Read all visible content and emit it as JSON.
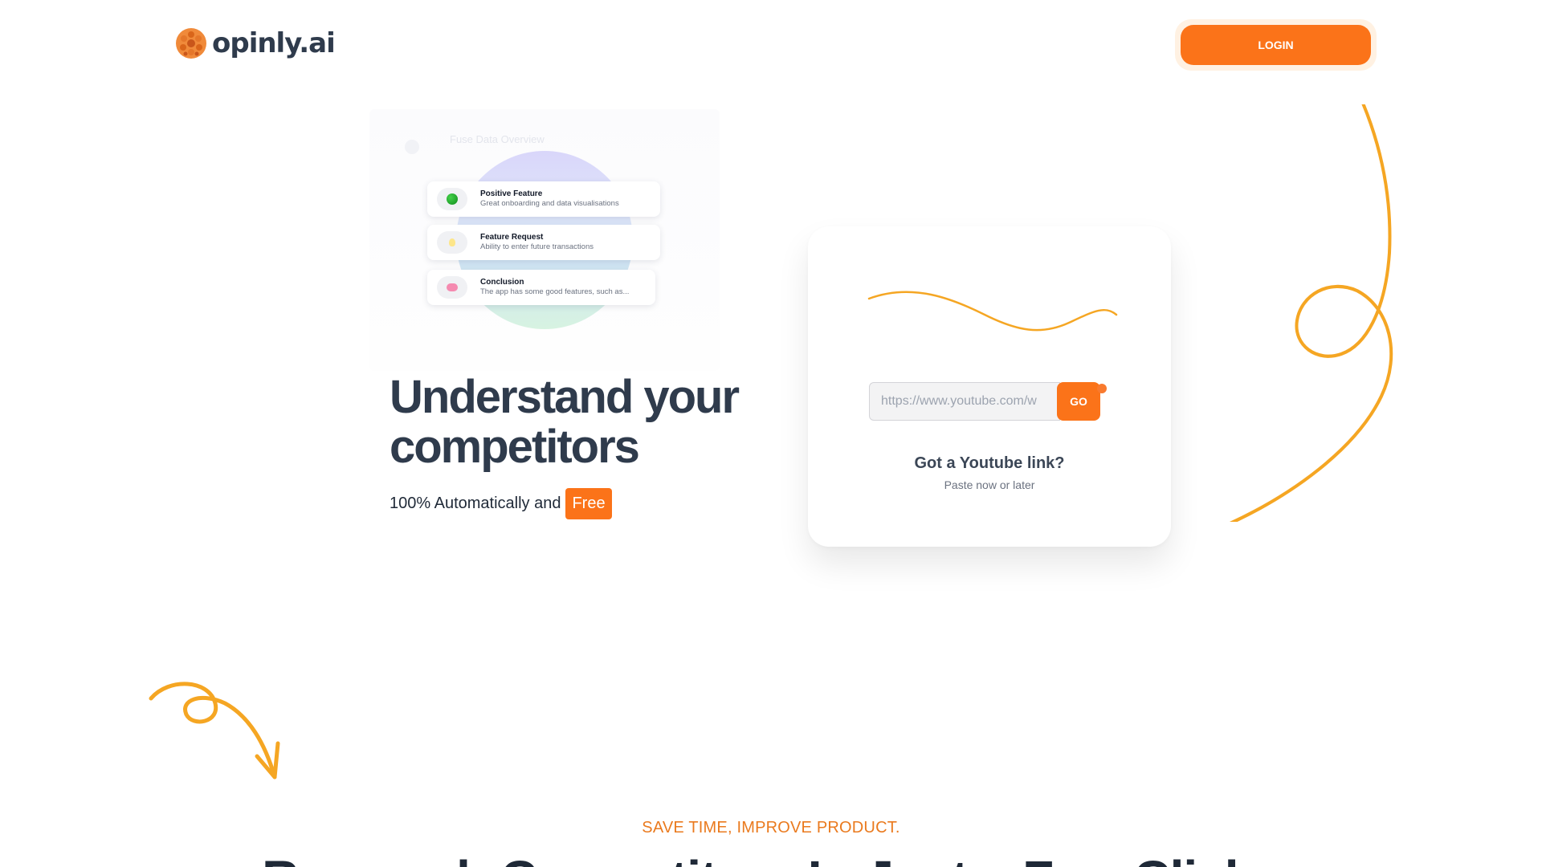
{
  "header": {
    "logo_text": "opinly.ai",
    "login_label": "LOGIN"
  },
  "preview": {
    "faint_label": "Fuse Data Overview",
    "cards": [
      {
        "icon": "green-circle-icon",
        "title": "Positive Feature",
        "subtitle": "Great onboarding and data visualisations"
      },
      {
        "icon": "lightbulb-icon",
        "title": "Feature Request",
        "subtitle": "Ability to enter future transactions"
      },
      {
        "icon": "brain-icon",
        "title": "Conclusion",
        "subtitle": "The app has some good features, such as..."
      }
    ]
  },
  "hero": {
    "title": "Understand your competitors",
    "subtitle": "100% Automatically and",
    "badge": "Free"
  },
  "url_card": {
    "input_placeholder": "https://www.youtube.com/w",
    "input_value": "",
    "go_label": "GO",
    "question": "Got a Youtube link?",
    "hint": "Paste now or later"
  },
  "section": {
    "kicker": "SAVE TIME, IMPROVE PRODUCT.",
    "heading": "Research Competitors In Just a Few Clicks"
  },
  "colors": {
    "accent": "#fb7319",
    "doodle": "#f5a623",
    "heading": "#2f3b4c"
  }
}
